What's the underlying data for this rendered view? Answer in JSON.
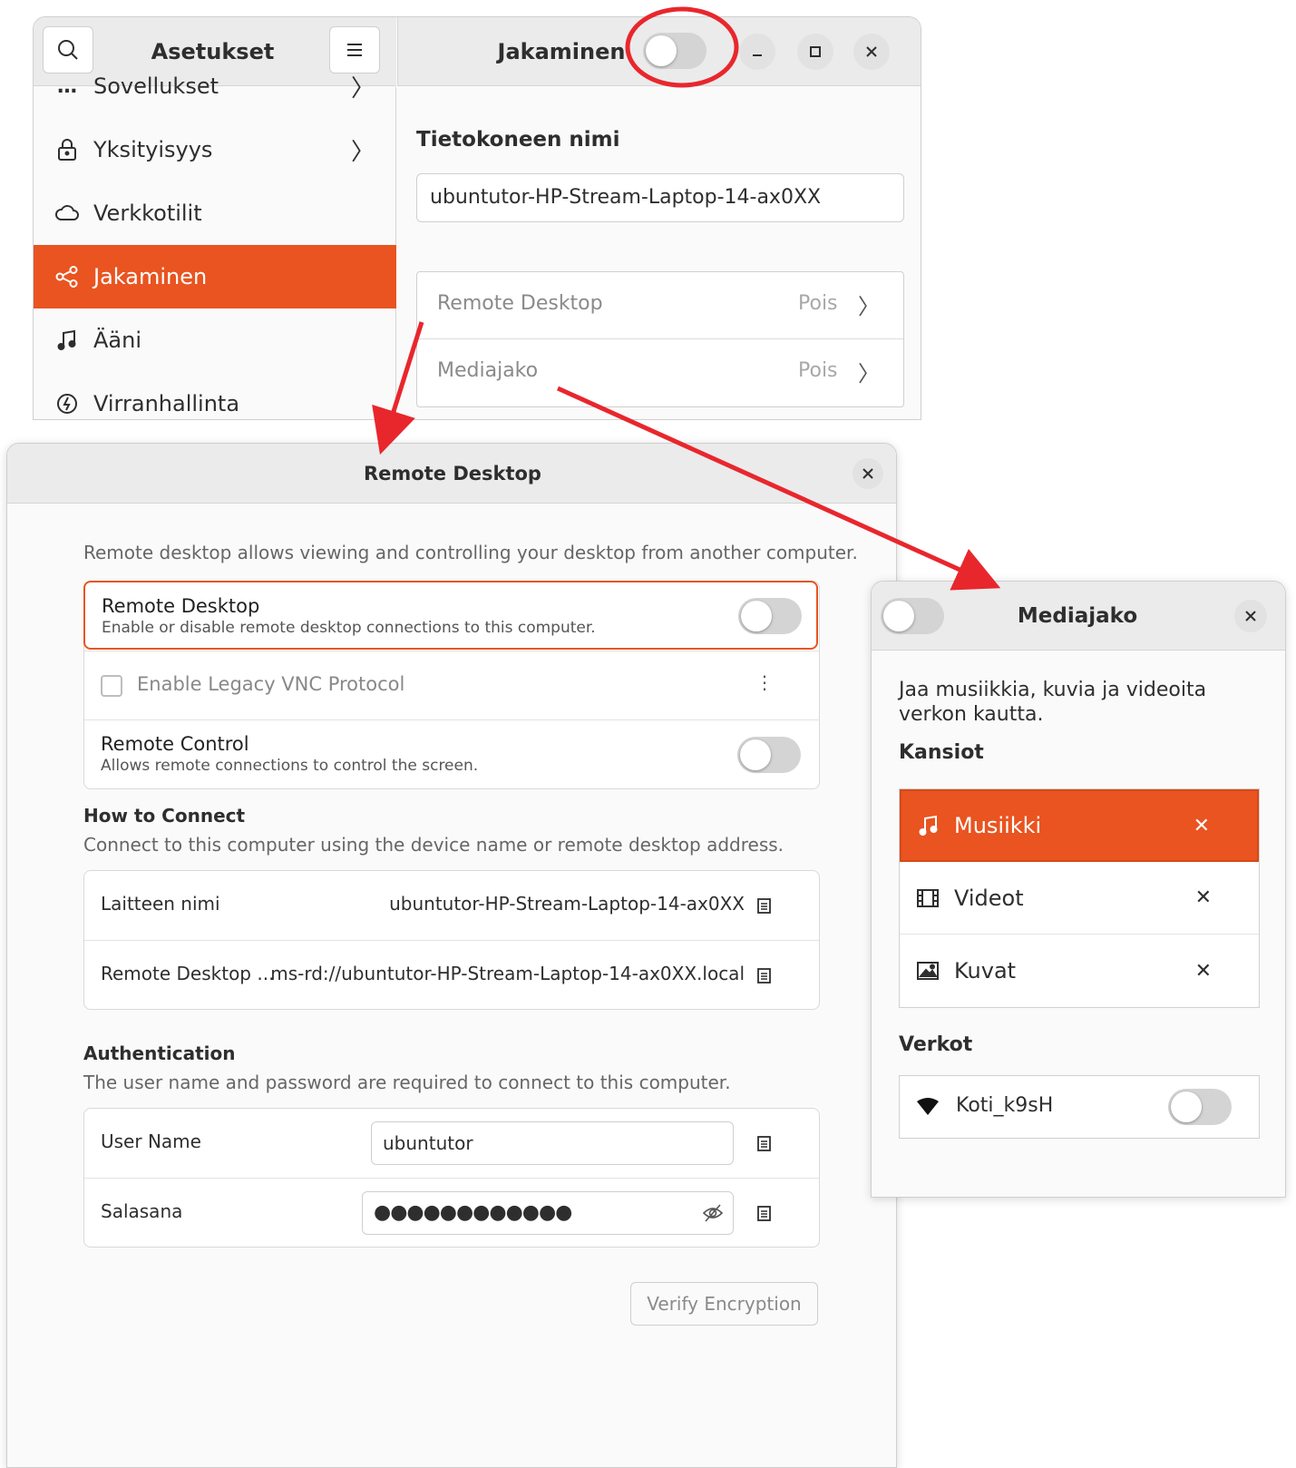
{
  "settings": {
    "title": "Asetukset",
    "panel_title": "Jakaminen",
    "sidebar_items": [
      {
        "label": "Sovellukset",
        "icon": "apps-icon"
      },
      {
        "label": "Yksityisyys",
        "icon": "lock-icon"
      },
      {
        "label": "Verkkotilit",
        "icon": "cloud-icon"
      },
      {
        "label": "Jakaminen",
        "icon": "share-icon"
      },
      {
        "label": "Ääni",
        "icon": "music-note-icon"
      },
      {
        "label": "Virranhallinta",
        "icon": "power-icon"
      }
    ],
    "computer_name_label": "Tietokoneen nimi",
    "computer_name_value": "ubuntutor-HP-Stream-Laptop-14-ax0XX",
    "services": [
      {
        "label": "Remote Desktop",
        "status": "Pois"
      },
      {
        "label": "Mediajako",
        "status": "Pois"
      }
    ]
  },
  "remote_desktop": {
    "title": "Remote Desktop",
    "intro": "Remote desktop allows viewing and controlling your desktop from another computer.",
    "rd_toggle_title": "Remote Desktop",
    "rd_toggle_sub": "Enable or disable remote desktop connections to this computer.",
    "legacy_vnc": "Enable Legacy VNC Protocol",
    "rc_title": "Remote Control",
    "rc_sub": "Allows remote connections to control the screen.",
    "how_title": "How to Connect",
    "how_sub": "Connect to this computer using the device name or remote desktop address.",
    "device_label": "Laitteen nimi",
    "device_value": "ubuntutor-HP-Stream-Laptop-14-ax0XX",
    "address_label": "Remote Desktop ...",
    "address_value": "ms-rd://ubuntutor-HP-Stream-Laptop-14-ax0XX.local",
    "auth_title": "Authentication",
    "auth_sub": "The user name and password are required to connect to this computer.",
    "username_label": "User Name",
    "username_value": "ubuntutor",
    "password_label": "Salasana",
    "password_value": "●●●●●●●●●●●●",
    "verify_button": "Verify Encryption"
  },
  "media_sharing": {
    "title": "Mediajako",
    "description": "Jaa musiikkia, kuvia ja videoita verkon kautta.",
    "folders_title": "Kansiot",
    "folders": [
      {
        "label": "Musiikki",
        "icon": "music-note-icon"
      },
      {
        "label": "Videot",
        "icon": "film-icon"
      },
      {
        "label": "Kuvat",
        "icon": "image-icon"
      }
    ],
    "networks_title": "Verkot",
    "network": "Koti_k9sH"
  },
  "colors": {
    "accent": "#e95420",
    "annotation": "#e8272d"
  }
}
